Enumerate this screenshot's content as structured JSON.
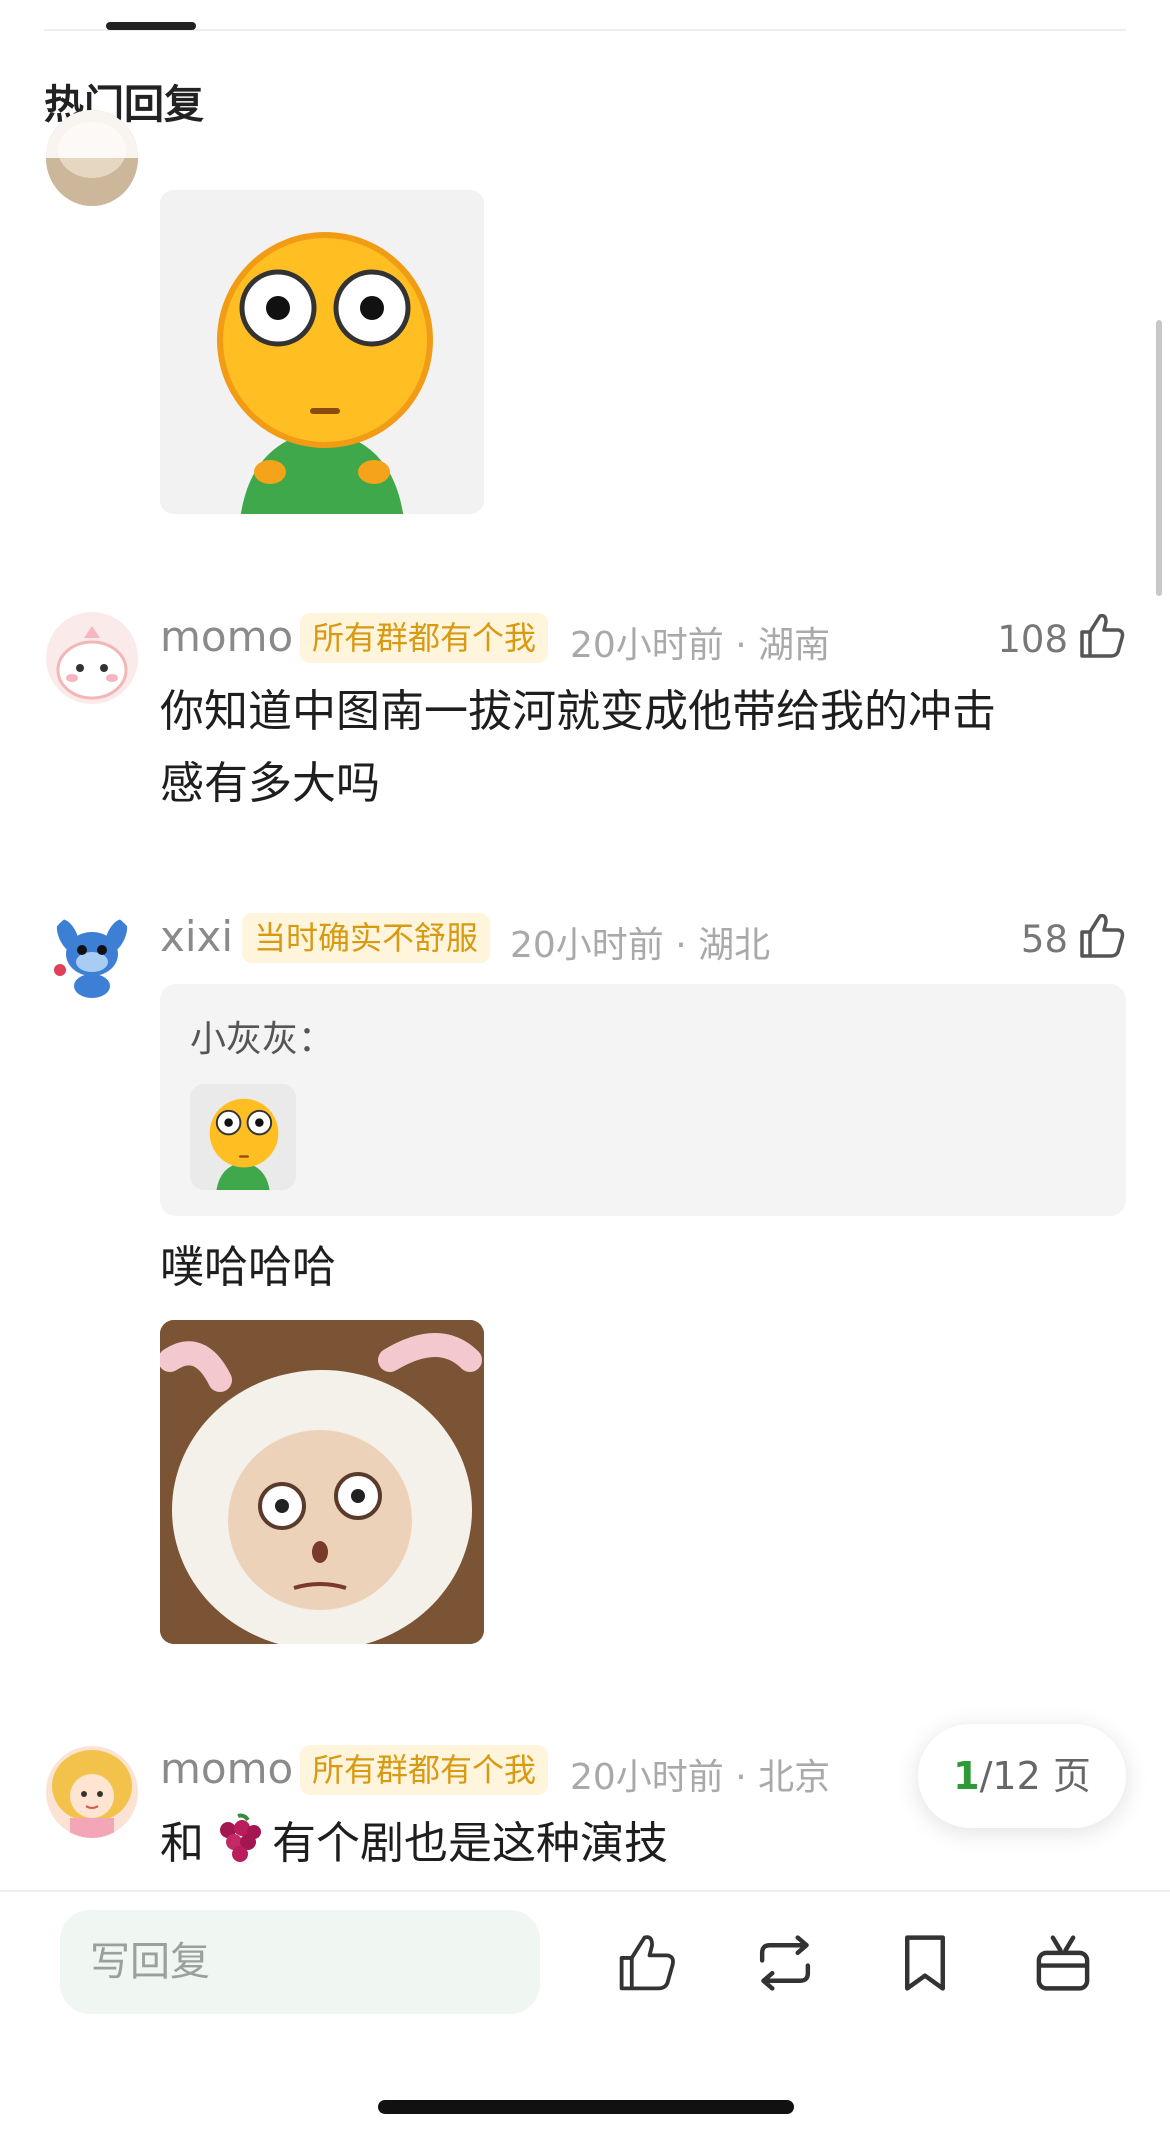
{
  "section": {
    "title": "热门回复"
  },
  "comments": [
    {
      "username": "momo",
      "badge": "所有群都有个我",
      "meta": "20小时前 · 湖南",
      "likes": "108",
      "text_lines": [
        "你知道中图南一拔河就变成他带给我的冲击",
        "感有多大吗"
      ]
    },
    {
      "username": "xixi",
      "badge": "当时确实不舒服",
      "meta": "20小时前 · 湖北",
      "likes": "58",
      "quote_author": "小灰灰：",
      "text": "噗哈哈哈"
    },
    {
      "username": "momo",
      "badge": "所有群都有个我",
      "meta": "20小时前 · 北京",
      "text_before": "和",
      "text_after": "有个剧也是这种演技"
    }
  ],
  "pagination": {
    "current": "1",
    "total_label": "/12 页"
  },
  "bottom_bar": {
    "reply_placeholder": "写回复"
  },
  "colors": {
    "badge_bg": "#fff5dc",
    "badge_text": "#d99a13",
    "page_current": "#2d9a36",
    "reply_input_bg": "#f0f6f2"
  },
  "icons": [
    "thumbs-up-icon",
    "repost-icon",
    "bookmark-icon",
    "gift-icon",
    "grapes-emoji"
  ]
}
